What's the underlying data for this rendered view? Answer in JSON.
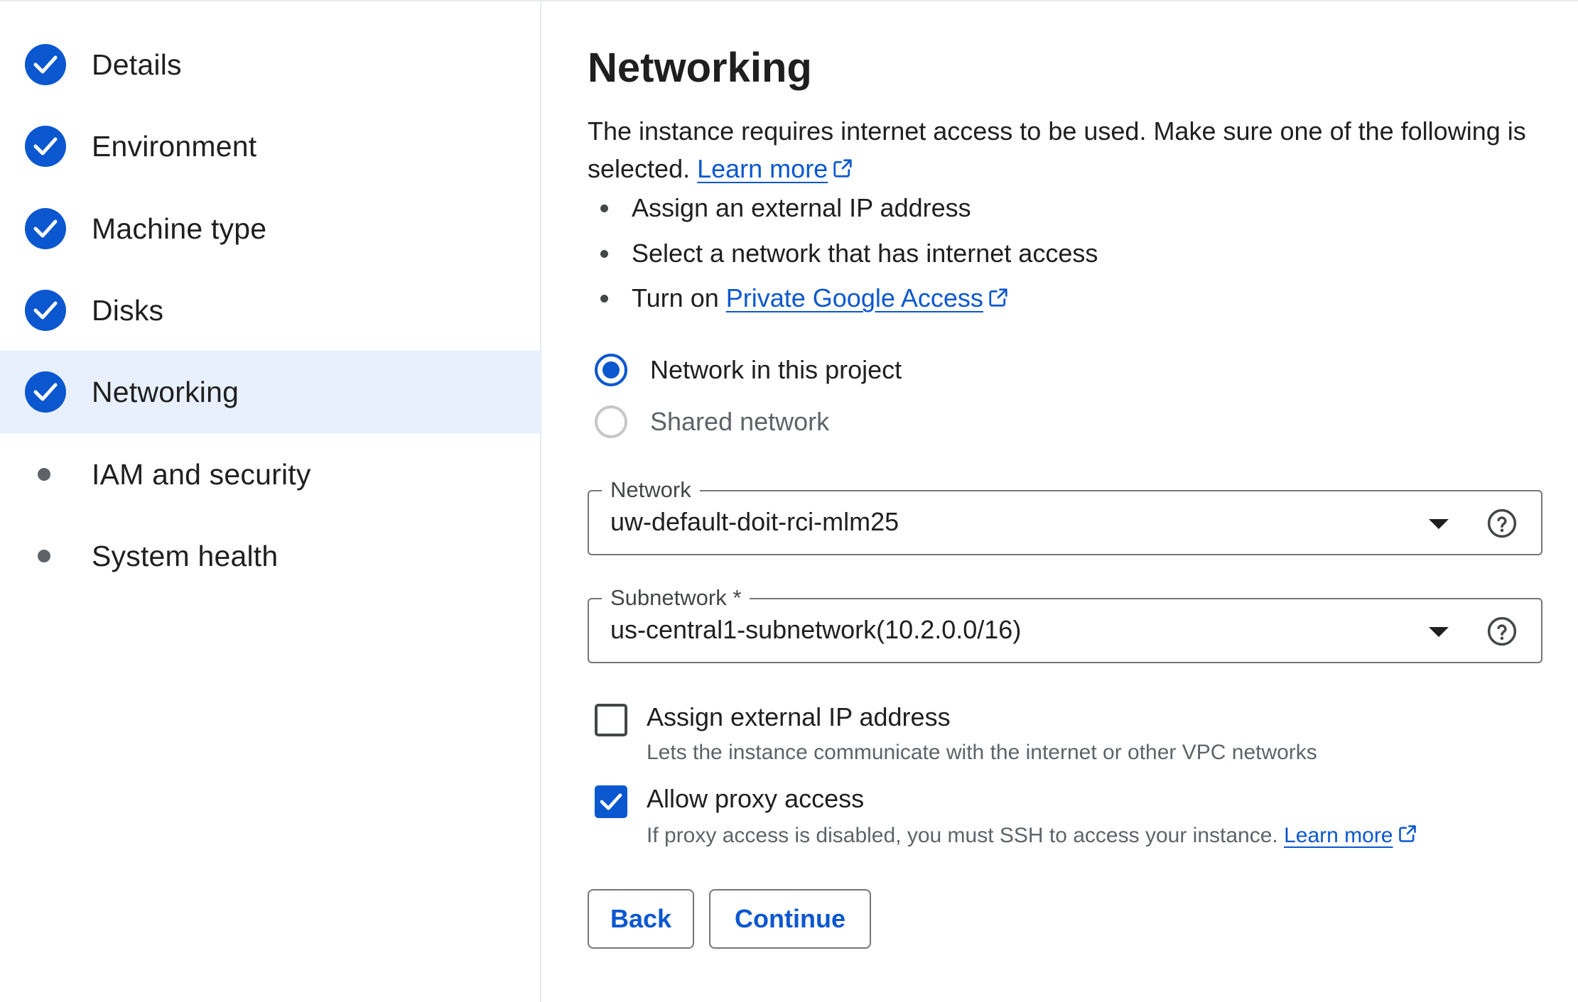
{
  "steps": [
    {
      "label": "Details",
      "state": "complete"
    },
    {
      "label": "Environment",
      "state": "complete"
    },
    {
      "label": "Machine type",
      "state": "complete"
    },
    {
      "label": "Disks",
      "state": "complete"
    },
    {
      "label": "Networking",
      "state": "complete",
      "active": true
    },
    {
      "label": "IAM and security",
      "state": "pending"
    },
    {
      "label": "System health",
      "state": "pending"
    }
  ],
  "main": {
    "title": "Networking",
    "intro_text": "The instance requires internet access to be used. Make sure one of the following is selected.",
    "intro_link": "Learn more",
    "bullets": [
      {
        "text": "Assign an external IP address"
      },
      {
        "text": "Select a network that has internet access"
      },
      {
        "prefix": "Turn on ",
        "link": "Private Google Access"
      }
    ],
    "radios": [
      {
        "label": "Network in this project",
        "selected": true
      },
      {
        "label": "Shared network",
        "selected": false
      }
    ],
    "network_field": {
      "label": "Network",
      "value": "uw-default-doit-rci-mlm25"
    },
    "subnetwork_field": {
      "label": "Subnetwork *",
      "value": "us-central1-subnetwork(10.2.0.0/16)"
    },
    "checkboxes": [
      {
        "label": "Assign external IP address",
        "help": "Lets the instance communicate with the internet or other VPC networks",
        "checked": false
      },
      {
        "label": "Allow proxy access",
        "help": "If proxy access is disabled, you must SSH to access your instance.",
        "help_link": "Learn more",
        "checked": true
      }
    ],
    "buttons": {
      "back": "Back",
      "continue": "Continue"
    }
  },
  "colors": {
    "accent": "#0b57d0",
    "active_bg": "#e8f0fe",
    "muted_text": "#5f6368"
  },
  "icons": [
    "check-circle-icon",
    "external-link-icon",
    "dropdown-arrow-icon",
    "help-icon",
    "checkbox-check-icon"
  ]
}
